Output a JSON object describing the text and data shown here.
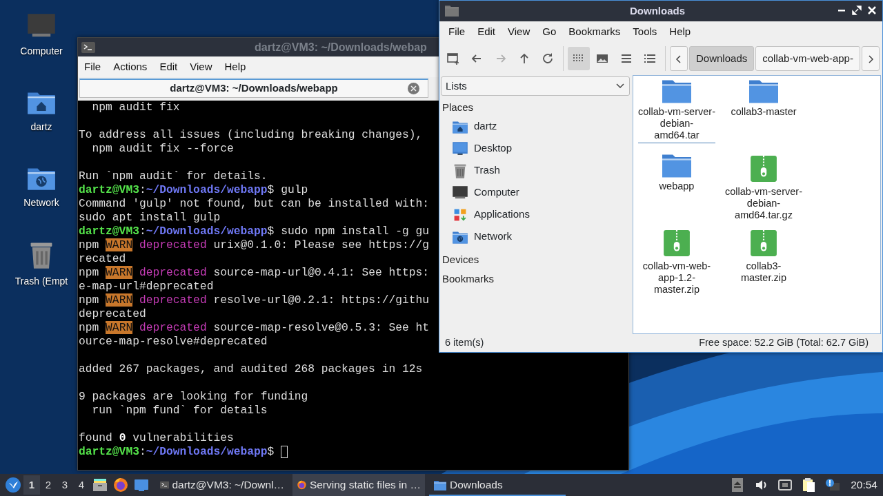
{
  "desktop_icons": [
    {
      "label": "Computer",
      "kind": "computer"
    },
    {
      "label": "dartz",
      "kind": "home"
    },
    {
      "label": "Network",
      "kind": "network"
    },
    {
      "label": "Trash (Empt",
      "kind": "trash"
    }
  ],
  "terminal": {
    "title": "dartz@VM3: ~/Downloads/webap",
    "menu": [
      "File",
      "Actions",
      "Edit",
      "View",
      "Help"
    ],
    "tab": {
      "label": "dartz@VM3: ~/Downloads/webapp"
    },
    "lines": [
      {
        "segments": [
          {
            "kind": "text",
            "text": "  npm audit fix"
          }
        ]
      },
      {
        "kind": "blank"
      },
      {
        "segments": [
          {
            "kind": "text",
            "text": "To address all issues (including breaking changes),"
          }
        ]
      },
      {
        "segments": [
          {
            "kind": "text",
            "text": "  npm audit fix --force"
          }
        ]
      },
      {
        "kind": "blank"
      },
      {
        "segments": [
          {
            "kind": "text",
            "text": "Run `npm audit` for details."
          }
        ]
      },
      {
        "segments": [
          {
            "kind": "user",
            "text": "dartz@VM3"
          },
          {
            "kind": "text",
            "text": ":"
          },
          {
            "kind": "path",
            "text": "~/Downloads/webapp"
          },
          {
            "kind": "text",
            "text": "$ gulp"
          }
        ]
      },
      {
        "segments": [
          {
            "kind": "text",
            "text": "Command 'gulp' not found, but can be installed with:"
          }
        ]
      },
      {
        "segments": [
          {
            "kind": "text",
            "text": "sudo apt install gulp"
          }
        ]
      },
      {
        "segments": [
          {
            "kind": "user",
            "text": "dartz@VM3"
          },
          {
            "kind": "text",
            "text": ":"
          },
          {
            "kind": "path",
            "text": "~/Downloads/webapp"
          },
          {
            "kind": "text",
            "text": "$ sudo npm install -g gu"
          }
        ]
      },
      {
        "segments": [
          {
            "kind": "text",
            "text": "npm "
          },
          {
            "kind": "warn",
            "text": "WARN"
          },
          {
            "kind": "deprecated",
            "text": " deprecated"
          },
          {
            "kind": "text",
            "text": " urix@0.1.0: Please see https://g"
          }
        ]
      },
      {
        "segments": [
          {
            "kind": "text",
            "text": "recated"
          }
        ]
      },
      {
        "segments": [
          {
            "kind": "text",
            "text": "npm "
          },
          {
            "kind": "warn",
            "text": "WARN"
          },
          {
            "kind": "deprecated",
            "text": " deprecated"
          },
          {
            "kind": "text",
            "text": " source-map-url@0.4.1: See https:"
          }
        ]
      },
      {
        "segments": [
          {
            "kind": "text",
            "text": "e-map-url#deprecated"
          }
        ]
      },
      {
        "segments": [
          {
            "kind": "text",
            "text": "npm "
          },
          {
            "kind": "warn",
            "text": "WARN"
          },
          {
            "kind": "deprecated",
            "text": " deprecated"
          },
          {
            "kind": "text",
            "text": " resolve-url@0.2.1: https://githu"
          }
        ]
      },
      {
        "segments": [
          {
            "kind": "text",
            "text": "deprecated"
          }
        ]
      },
      {
        "segments": [
          {
            "kind": "text",
            "text": "npm "
          },
          {
            "kind": "warn",
            "text": "WARN"
          },
          {
            "kind": "deprecated",
            "text": " deprecated"
          },
          {
            "kind": "text",
            "text": " source-map-resolve@0.5.3: See ht"
          }
        ]
      },
      {
        "segments": [
          {
            "kind": "text",
            "text": "ource-map-resolve#deprecated"
          }
        ]
      },
      {
        "kind": "blank"
      },
      {
        "segments": [
          {
            "kind": "text",
            "text": "added 267 packages, and audited 268 packages in 12s"
          }
        ]
      },
      {
        "kind": "blank"
      },
      {
        "segments": [
          {
            "kind": "text",
            "text": "9 packages are looking for funding"
          }
        ]
      },
      {
        "segments": [
          {
            "kind": "text",
            "text": "  run `npm fund` for details"
          }
        ]
      },
      {
        "kind": "blank"
      },
      {
        "segments": [
          {
            "kind": "text",
            "text": "found "
          },
          {
            "kind": "bold",
            "text": "0"
          },
          {
            "kind": "text",
            "text": " vulnerabilities"
          }
        ]
      },
      {
        "segments": [
          {
            "kind": "user",
            "text": "dartz@VM3"
          },
          {
            "kind": "text",
            "text": ":"
          },
          {
            "kind": "path",
            "text": "~/Downloads/webapp"
          },
          {
            "kind": "text",
            "text": "$ "
          }
        ],
        "cursor": true
      }
    ]
  },
  "file_manager": {
    "title": "Downloads",
    "menu": [
      "File",
      "Edit",
      "View",
      "Go",
      "Bookmarks",
      "Tools",
      "Help"
    ],
    "nav_buttons": [
      {
        "kind": "new-window",
        "disabled": false
      },
      {
        "kind": "back",
        "disabled": false
      },
      {
        "kind": "forward",
        "disabled": true
      },
      {
        "kind": "up",
        "disabled": false
      },
      {
        "kind": "reload",
        "disabled": false
      }
    ],
    "view_buttons": [
      {
        "kind": "icons",
        "selected": true
      },
      {
        "kind": "thumbnails",
        "selected": false
      },
      {
        "kind": "compact",
        "selected": false
      },
      {
        "kind": "details",
        "selected": false
      }
    ],
    "path": [
      {
        "label": "Downloads",
        "selected": true
      },
      {
        "label": "collab-vm-web-app-",
        "selected": false
      }
    ],
    "side_pane": {
      "mode": "Lists",
      "sections": [
        {
          "label": "Places",
          "items": [
            {
              "label": "dartz",
              "kind": "home"
            },
            {
              "label": "Desktop",
              "kind": "desktop"
            },
            {
              "label": "Trash",
              "kind": "trash"
            },
            {
              "label": "Computer",
              "kind": "computer"
            },
            {
              "label": "Applications",
              "kind": "applications"
            },
            {
              "label": "Network",
              "kind": "network"
            }
          ]
        },
        {
          "label": "Devices"
        },
        {
          "label": "Bookmarks"
        }
      ]
    },
    "files": [
      {
        "name": "collab-vm-server-debian-amd64.tar",
        "kind": "folder",
        "focused": true
      },
      {
        "name": "collab3-master",
        "kind": "folder",
        "focused": false
      },
      {
        "name": "webapp",
        "kind": "folder",
        "focused": false
      },
      {
        "name": "collab-vm-server-debian-amd64.tar.gz",
        "kind": "archive",
        "focused": false
      },
      {
        "name": "collab-vm-web-app-1.2-master.zip",
        "kind": "archive",
        "focused": false
      },
      {
        "name": "collab3-master.zip",
        "kind": "archive",
        "focused": false
      }
    ],
    "status": {
      "count": "6 item(s)",
      "free_space": "Free space: 52.2 GiB (Total: 62.7 GiB)"
    }
  },
  "taskbar": {
    "workspaces": [
      {
        "label": "1",
        "selected": true
      },
      {
        "label": "2",
        "selected": false
      },
      {
        "label": "3",
        "selected": false
      },
      {
        "label": "4",
        "selected": false
      }
    ],
    "launchers": [
      {
        "kind": "file-manager"
      },
      {
        "kind": "browser"
      },
      {
        "kind": "desktop"
      }
    ],
    "tasks": [
      {
        "label": "dartz@VM3: ~/Downl…",
        "kind": "terminal",
        "selected": false,
        "highlighted": false
      },
      {
        "label": "Serving static files in …",
        "kind": "browser",
        "selected": false,
        "highlighted": true
      },
      {
        "label": "Downloads",
        "kind": "folder",
        "selected": true,
        "highlighted": false
      }
    ],
    "tray": [
      {
        "kind": "eject"
      },
      {
        "kind": "volume"
      },
      {
        "kind": "network"
      },
      {
        "kind": "clipboard"
      },
      {
        "kind": "notification"
      }
    ],
    "clock": "20:54"
  }
}
